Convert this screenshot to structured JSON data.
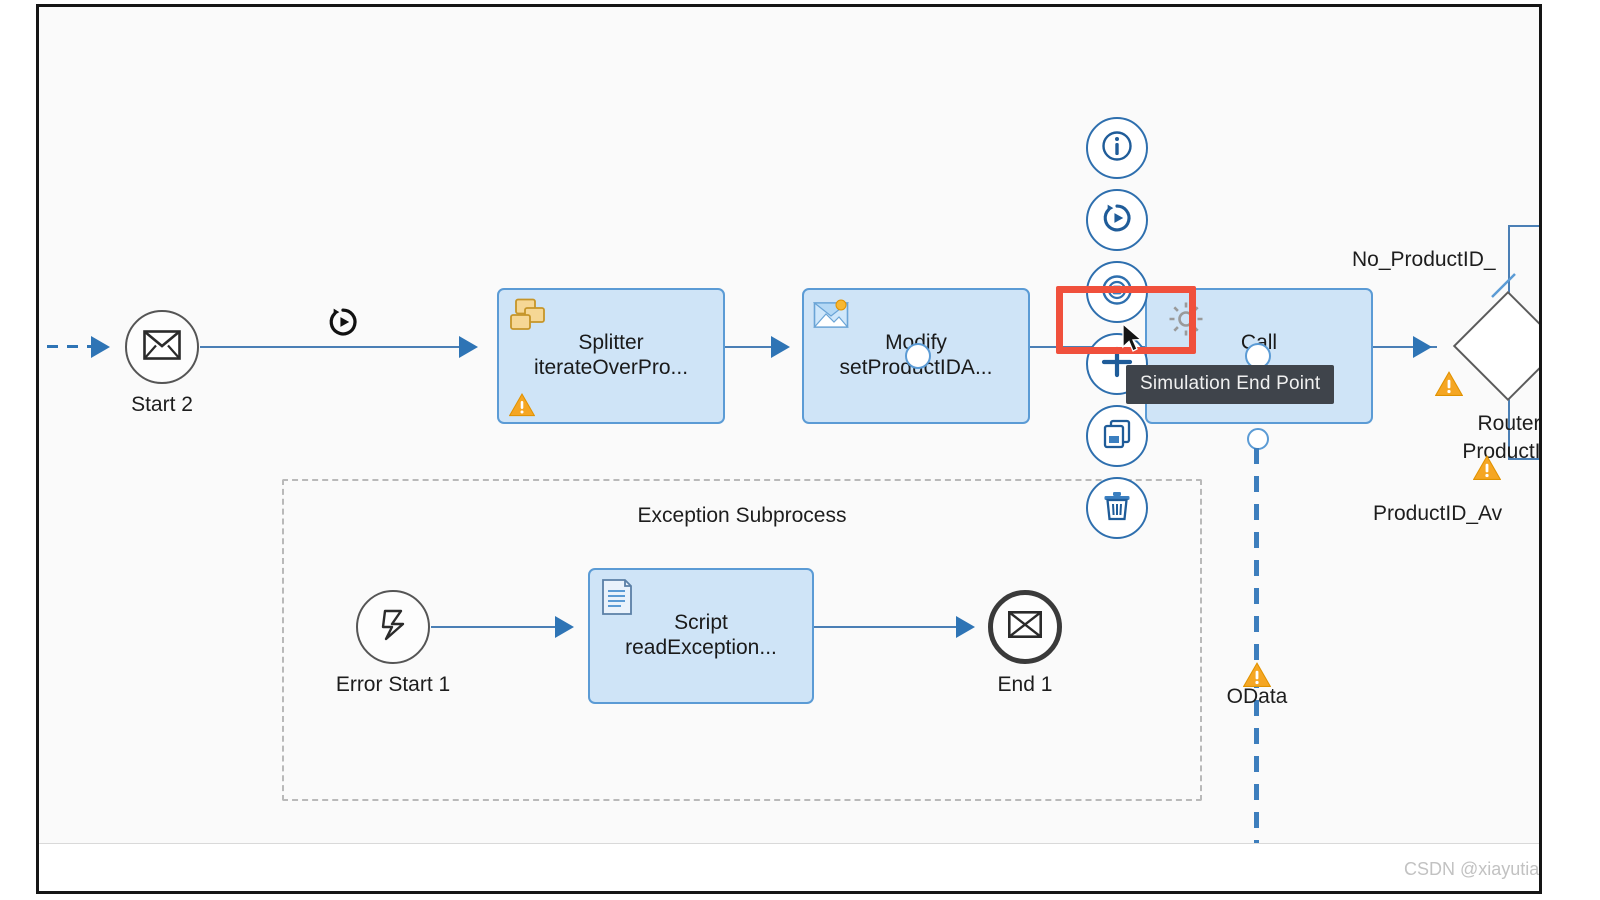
{
  "canvas": {
    "background_color": "#fafafa",
    "border_color": "#151515"
  },
  "tooltip": {
    "text": "Simulation End Point",
    "background_color": "#3f444b",
    "text_color": "#f0f0f0"
  },
  "highlight": {
    "color": "#f0503c"
  },
  "toolbar": {
    "buttons": [
      {
        "icon": "info-icon",
        "label": "Info"
      },
      {
        "icon": "simulation-start-point-icon",
        "label": "Simulation Start Point"
      },
      {
        "icon": "simulation-end-point-icon",
        "label": "Simulation End Point"
      },
      {
        "icon": "add-icon",
        "label": "Add"
      },
      {
        "icon": "copy-icon",
        "label": "Copy"
      },
      {
        "icon": "delete-icon",
        "label": "Delete"
      }
    ],
    "accent_color": "#2e6fae"
  },
  "main_flow": {
    "start_event": {
      "label": "Start 2",
      "icon": "message-start-event-icon"
    },
    "link_marker": {
      "icon": "simulation-start-point-icon"
    },
    "tasks": [
      {
        "title_line1": "Splitter",
        "title_line2": "iterateOverPro...",
        "icon": "splitter-icon",
        "has_warning": true
      },
      {
        "title_line1": "Modify",
        "title_line2": "setProductIDA...",
        "icon": "content-modifier-icon",
        "has_warning": false
      },
      {
        "title_line1": "Call",
        "title_line2": "",
        "icon": "gear-icon",
        "has_warning": false
      }
    ],
    "router": {
      "label_line1": "Router",
      "label_line2": "ProductID",
      "branch_top_label": "No_ProductID_",
      "branch_bottom_label": "ProductID_Av"
    },
    "odata": {
      "label": "OData",
      "has_warning": true
    }
  },
  "subprocess": {
    "title": "Exception Subprocess",
    "start_event": {
      "label": "Error Start 1",
      "icon": "error-start-event-icon"
    },
    "task": {
      "title_line1": "Script",
      "title_line2": "readException...",
      "icon": "script-icon"
    },
    "end_event": {
      "label": "End 1",
      "icon": "message-end-event-icon"
    }
  },
  "watermark": {
    "text": "CSDN @xiayutian_c"
  }
}
